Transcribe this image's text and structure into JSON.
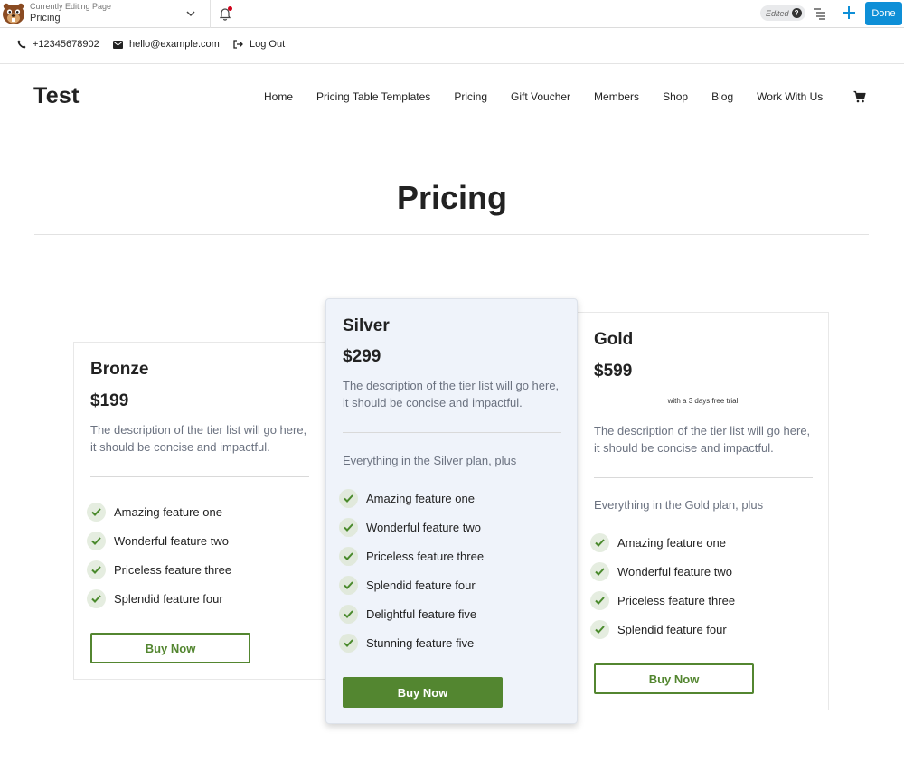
{
  "builder_bar": {
    "editing_label": "Currently Editing Page",
    "editing_page": "Pricing",
    "edited_label": "Edited",
    "help_glyph": "?",
    "done_label": "Done",
    "icons": [
      "beaver-logo-icon",
      "chevron-down-icon",
      "bell-icon",
      "help-icon",
      "outline-list-icon",
      "plus-icon"
    ],
    "accent_color": "#0e8fd7"
  },
  "info_bar": {
    "phone": "+12345678902",
    "email": "hello@example.com",
    "logout": "Log Out"
  },
  "header": {
    "site_title": "Test",
    "nav": [
      "Home",
      "Pricing Table Templates",
      "Pricing",
      "Gift Voucher",
      "Members",
      "Shop",
      "Blog",
      "Work With Us"
    ],
    "cart_icon": "cart-icon"
  },
  "page": {
    "title": "Pricing"
  },
  "plans": [
    {
      "name": "Bronze",
      "price": "$199",
      "trial": "",
      "description": "The description of the tier list will go here, it should be concise and impactful.",
      "plus_text": "",
      "features": [
        "Amazing feature one",
        "Wonderful feature two",
        "Priceless feature three",
        "Splendid feature four"
      ],
      "button": "Buy Now"
    },
    {
      "name": "Silver",
      "price": "$299",
      "trial": "",
      "description": "The description of the tier list will go here, it should be concise and impactful.",
      "plus_text": "Everything in the Silver plan, plus",
      "features": [
        "Amazing feature one",
        "Wonderful feature two",
        "Priceless feature three",
        "Splendid feature four",
        "Delightful feature five",
        "Stunning feature five"
      ],
      "button": "Buy Now"
    },
    {
      "name": "Gold",
      "price": "$599",
      "trial": "with a 3 days free trial",
      "description": "The description of the tier list will go here, it should be concise and impactful.",
      "plus_text": "Everything in the Gold plan, plus",
      "features": [
        "Amazing feature one",
        "Wonderful feature two",
        "Priceless feature three",
        "Splendid feature four"
      ],
      "button": "Buy Now"
    }
  ],
  "colors": {
    "brand_green": "#538630",
    "featured_card_bg": "#eff3fa",
    "check_icon": "#4a8a2c",
    "notification_dot": "#d0021b"
  }
}
